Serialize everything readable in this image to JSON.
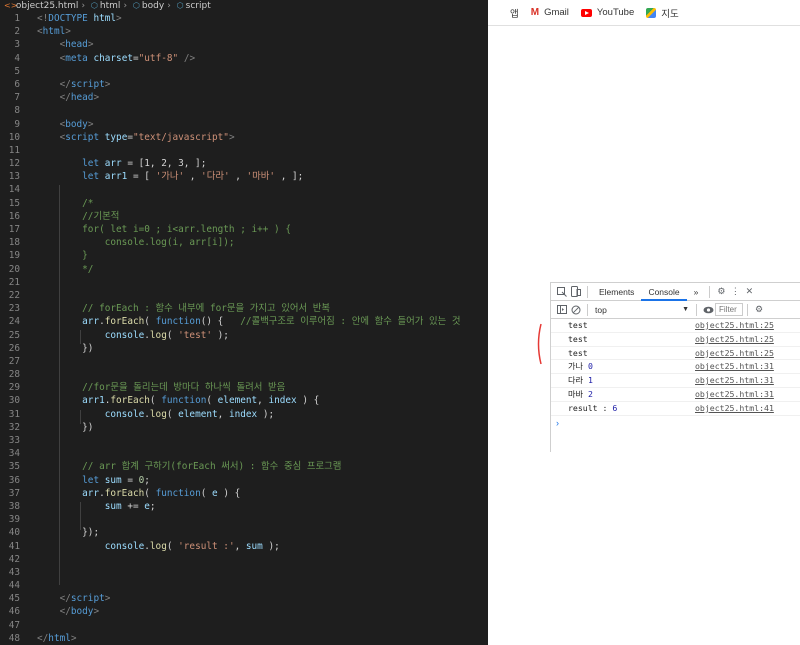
{
  "editor": {
    "breadcrumb": [
      "object25.html",
      "html",
      "body",
      "script"
    ],
    "lines": [
      {
        "n": "1",
        "t": [
          [
            "tok-punc",
            "<!"
          ],
          [
            "tok-tag",
            "DOCTYPE"
          ],
          [
            "tok-plain",
            " "
          ],
          [
            "tok-attr",
            "html"
          ],
          [
            "tok-punc",
            ">"
          ]
        ]
      },
      {
        "n": "2",
        "t": [
          [
            "tok-punc",
            "<"
          ],
          [
            "tok-tag",
            "html"
          ],
          [
            "tok-punc",
            ">"
          ]
        ]
      },
      {
        "n": "3",
        "t": [
          [
            "tok-plain",
            "    "
          ],
          [
            "tok-punc",
            "<"
          ],
          [
            "tok-tag",
            "head"
          ],
          [
            "tok-punc",
            ">"
          ]
        ]
      },
      {
        "n": "4",
        "t": [
          [
            "tok-plain",
            "    "
          ],
          [
            "tok-punc",
            "<"
          ],
          [
            "tok-tag",
            "meta"
          ],
          [
            "tok-plain",
            " "
          ],
          [
            "tok-attr",
            "charset"
          ],
          [
            "tok-plain",
            "="
          ],
          [
            "tok-str",
            "\"utf-8\""
          ],
          [
            "tok-plain",
            " "
          ],
          [
            "tok-punc",
            "/>"
          ]
        ]
      },
      {
        "n": "5",
        "t": []
      },
      {
        "n": "6",
        "t": [
          [
            "tok-plain",
            "    "
          ],
          [
            "tok-punc",
            "</"
          ],
          [
            "tok-tag",
            "script"
          ],
          [
            "tok-punc",
            ">"
          ]
        ]
      },
      {
        "n": "7",
        "t": [
          [
            "tok-plain",
            "    "
          ],
          [
            "tok-punc",
            "</"
          ],
          [
            "tok-tag",
            "head"
          ],
          [
            "tok-punc",
            ">"
          ]
        ]
      },
      {
        "n": "8",
        "t": []
      },
      {
        "n": "9",
        "t": [
          [
            "tok-plain",
            "    "
          ],
          [
            "tok-punc",
            "<"
          ],
          [
            "tok-tag",
            "body"
          ],
          [
            "tok-punc",
            ">"
          ]
        ]
      },
      {
        "n": "10",
        "t": [
          [
            "tok-plain",
            "    "
          ],
          [
            "tok-punc",
            "<"
          ],
          [
            "tok-tag",
            "script"
          ],
          [
            "tok-plain",
            " "
          ],
          [
            "tok-attr",
            "type"
          ],
          [
            "tok-plain",
            "="
          ],
          [
            "tok-str",
            "\"text/javascript\""
          ],
          [
            "tok-punc",
            ">"
          ]
        ]
      },
      {
        "n": "11",
        "t": []
      },
      {
        "n": "12",
        "t": [
          [
            "tok-plain",
            "        "
          ],
          [
            "tok-kw",
            "let"
          ],
          [
            "tok-plain",
            " "
          ],
          [
            "tok-var",
            "arr"
          ],
          [
            "tok-plain",
            " = [1, 2, 3, ];"
          ]
        ]
      },
      {
        "n": "13",
        "t": [
          [
            "tok-plain",
            "        "
          ],
          [
            "tok-kw",
            "let"
          ],
          [
            "tok-plain",
            " "
          ],
          [
            "tok-var",
            "arr1"
          ],
          [
            "tok-plain",
            " = [ "
          ],
          [
            "tok-str",
            "'가나'"
          ],
          [
            "tok-plain",
            " , "
          ],
          [
            "tok-str",
            "'다라'"
          ],
          [
            "tok-plain",
            " , "
          ],
          [
            "tok-str",
            "'마바'"
          ],
          [
            "tok-plain",
            " , ];"
          ]
        ]
      },
      {
        "n": "14",
        "t": []
      },
      {
        "n": "15",
        "t": [
          [
            "tok-plain",
            "        "
          ],
          [
            "tok-com",
            "/*"
          ]
        ]
      },
      {
        "n": "16",
        "t": [
          [
            "tok-plain",
            "        "
          ],
          [
            "tok-com",
            "//기본적"
          ]
        ]
      },
      {
        "n": "17",
        "t": [
          [
            "tok-plain",
            "        "
          ],
          [
            "tok-com",
            "for( let i=0 ; i<arr.length ; i++ ) {"
          ]
        ]
      },
      {
        "n": "18",
        "t": [
          [
            "tok-plain",
            "            "
          ],
          [
            "tok-com",
            "console.log(i, arr[i]);"
          ]
        ]
      },
      {
        "n": "19",
        "t": [
          [
            "tok-plain",
            "        "
          ],
          [
            "tok-com",
            "}"
          ]
        ]
      },
      {
        "n": "20",
        "t": [
          [
            "tok-plain",
            "        "
          ],
          [
            "tok-com",
            "*/"
          ]
        ]
      },
      {
        "n": "21",
        "t": []
      },
      {
        "n": "22",
        "t": []
      },
      {
        "n": "23",
        "t": [
          [
            "tok-plain",
            "        "
          ],
          [
            "tok-com",
            "// forEach : 함수 내부에 for문을 가지고 있어서 반복"
          ]
        ]
      },
      {
        "n": "24",
        "t": [
          [
            "tok-plain",
            "        "
          ],
          [
            "tok-var",
            "arr"
          ],
          [
            "tok-plain",
            "."
          ],
          [
            "tok-fn",
            "forEach"
          ],
          [
            "tok-plain",
            "( "
          ],
          [
            "tok-kw",
            "function"
          ],
          [
            "tok-plain",
            "() {   "
          ],
          [
            "tok-com",
            "//콜백구조로 이루어짐 : 안에 함수 들어가 있는 것"
          ]
        ]
      },
      {
        "n": "25",
        "t": [
          [
            "tok-plain",
            "            "
          ],
          [
            "tok-var",
            "console"
          ],
          [
            "tok-plain",
            "."
          ],
          [
            "tok-fn",
            "log"
          ],
          [
            "tok-plain",
            "( "
          ],
          [
            "tok-str",
            "'test'"
          ],
          [
            "tok-plain",
            " );"
          ]
        ]
      },
      {
        "n": "26",
        "t": [
          [
            "tok-plain",
            "        })"
          ]
        ]
      },
      {
        "n": "27",
        "t": []
      },
      {
        "n": "28",
        "t": []
      },
      {
        "n": "29",
        "t": [
          [
            "tok-plain",
            "        "
          ],
          [
            "tok-com",
            "//for문을 돌리는데 방마다 하나씩 돌려서 받음"
          ]
        ]
      },
      {
        "n": "30",
        "t": [
          [
            "tok-plain",
            "        "
          ],
          [
            "tok-var",
            "arr1"
          ],
          [
            "tok-plain",
            "."
          ],
          [
            "tok-fn",
            "forEach"
          ],
          [
            "tok-plain",
            "( "
          ],
          [
            "tok-kw",
            "function"
          ],
          [
            "tok-plain",
            "( "
          ],
          [
            "tok-var",
            "element"
          ],
          [
            "tok-plain",
            ", "
          ],
          [
            "tok-var",
            "index"
          ],
          [
            "tok-plain",
            " ) {"
          ]
        ]
      },
      {
        "n": "31",
        "t": [
          [
            "tok-plain",
            "            "
          ],
          [
            "tok-var",
            "console"
          ],
          [
            "tok-plain",
            "."
          ],
          [
            "tok-fn",
            "log"
          ],
          [
            "tok-plain",
            "( "
          ],
          [
            "tok-var",
            "element"
          ],
          [
            "tok-plain",
            ", "
          ],
          [
            "tok-var",
            "index"
          ],
          [
            "tok-plain",
            " );"
          ]
        ]
      },
      {
        "n": "32",
        "t": [
          [
            "tok-plain",
            "        })"
          ]
        ]
      },
      {
        "n": "33",
        "t": []
      },
      {
        "n": "34",
        "t": []
      },
      {
        "n": "35",
        "t": [
          [
            "tok-plain",
            "        "
          ],
          [
            "tok-com",
            "// arr 합계 구하기(forEach 써서) : 함수 중심 프로그램"
          ]
        ]
      },
      {
        "n": "36",
        "t": [
          [
            "tok-plain",
            "        "
          ],
          [
            "tok-kw",
            "let"
          ],
          [
            "tok-plain",
            " "
          ],
          [
            "tok-var",
            "sum"
          ],
          [
            "tok-plain",
            " = "
          ],
          [
            "tok-num",
            "0"
          ],
          [
            "tok-plain",
            ";"
          ]
        ]
      },
      {
        "n": "37",
        "t": [
          [
            "tok-plain",
            "        "
          ],
          [
            "tok-var",
            "arr"
          ],
          [
            "tok-plain",
            "."
          ],
          [
            "tok-fn",
            "forEach"
          ],
          [
            "tok-plain",
            "( "
          ],
          [
            "tok-kw",
            "function"
          ],
          [
            "tok-plain",
            "( "
          ],
          [
            "tok-var",
            "e"
          ],
          [
            "tok-plain",
            " ) {"
          ]
        ]
      },
      {
        "n": "38",
        "t": [
          [
            "tok-plain",
            "            "
          ],
          [
            "tok-var",
            "sum"
          ],
          [
            "tok-plain",
            " += "
          ],
          [
            "tok-var",
            "e"
          ],
          [
            "tok-plain",
            ";"
          ]
        ]
      },
      {
        "n": "39",
        "t": []
      },
      {
        "n": "40",
        "t": [
          [
            "tok-plain",
            "        });"
          ]
        ]
      },
      {
        "n": "41",
        "t": [
          [
            "tok-plain",
            "            "
          ],
          [
            "tok-var",
            "console"
          ],
          [
            "tok-plain",
            "."
          ],
          [
            "tok-fn",
            "log"
          ],
          [
            "tok-plain",
            "( "
          ],
          [
            "tok-str",
            "'result :'"
          ],
          [
            "tok-plain",
            ", "
          ],
          [
            "tok-var",
            "sum"
          ],
          [
            "tok-plain",
            " );"
          ]
        ]
      },
      {
        "n": "42",
        "t": []
      },
      {
        "n": "43",
        "t": []
      },
      {
        "n": "44",
        "t": []
      },
      {
        "n": "45",
        "t": [
          [
            "tok-plain",
            "    "
          ],
          [
            "tok-punc",
            "</"
          ],
          [
            "tok-tag",
            "script"
          ],
          [
            "tok-punc",
            ">"
          ]
        ]
      },
      {
        "n": "46",
        "t": [
          [
            "tok-plain",
            "    "
          ],
          [
            "tok-punc",
            "</"
          ],
          [
            "tok-tag",
            "body"
          ],
          [
            "tok-punc",
            ">"
          ]
        ]
      },
      {
        "n": "47",
        "t": []
      },
      {
        "n": "48",
        "t": [
          [
            "tok-punc",
            "</"
          ],
          [
            "tok-tag",
            "html"
          ],
          [
            "tok-punc",
            ">"
          ]
        ]
      }
    ]
  },
  "bookmarks": {
    "apps_label": "앱",
    "gmail_label": "Gmail",
    "youtube_label": "YouTube",
    "maps_label": "지도",
    "gmail_icon_text": "M"
  },
  "devtools": {
    "tabs": [
      "Elements",
      "Console"
    ],
    "active_tab": "Console",
    "more_label": "»",
    "context_value": "top",
    "filter_placeholder": "Filter",
    "rows": [
      {
        "msg": "test",
        "num": "",
        "src": "object25.html:25"
      },
      {
        "msg": "test",
        "num": "",
        "src": "object25.html:25"
      },
      {
        "msg": "test",
        "num": "",
        "src": "object25.html:25"
      },
      {
        "msg": "가나 ",
        "num": "0",
        "src": "object25.html:31"
      },
      {
        "msg": "다라 ",
        "num": "1",
        "src": "object25.html:31"
      },
      {
        "msg": "마바 ",
        "num": "2",
        "src": "object25.html:31"
      },
      {
        "msg": "result : ",
        "num": "6",
        "src": "object25.html:41"
      }
    ],
    "prompt_symbol": "›"
  },
  "colors": {
    "editor_bg": "#1e1e1e",
    "accent": "#1a73e8",
    "annotation": "#e53935"
  }
}
